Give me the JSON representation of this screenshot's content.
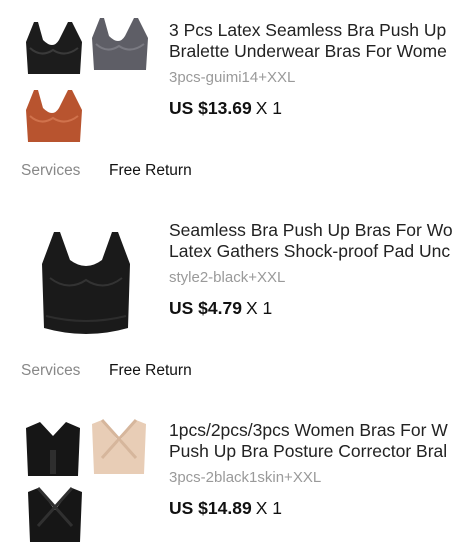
{
  "orders": [
    {
      "title_line1": "3 Pcs Latex Seamless Bra Push Up",
      "title_line2": "Bralette Underwear  Bras For Wome",
      "variant": "3pcs-guimi14+XXL",
      "price": "US $13.69",
      "qty": "X 1",
      "colors": [
        "#1c1c1c",
        "#5e5e66",
        "#b8542f"
      ]
    },
    {
      "title_line1": "Seamless Bra Push Up Bras For Wo",
      "title_line2": "Latex Gathers Shock-proof Pad Unc",
      "variant": "style2-black+XXL",
      "price": "US $4.79",
      "qty": "X 1",
      "colors": [
        "#1a1a1a"
      ]
    },
    {
      "title_line1": "1pcs/2pcs/3pcs Women Bras For W",
      "title_line2": "Push Up Bra Posture Corrector Bral",
      "variant": "3pcs-2black1skin+XXL",
      "price": "US $14.89",
      "qty": "X 1",
      "colors": [
        "#161616",
        "#e8cdb6",
        "#161616"
      ]
    }
  ],
  "services": [
    {
      "label": "Services",
      "value": "Free Return"
    },
    {
      "label": "Services",
      "value": "Free Return"
    }
  ]
}
